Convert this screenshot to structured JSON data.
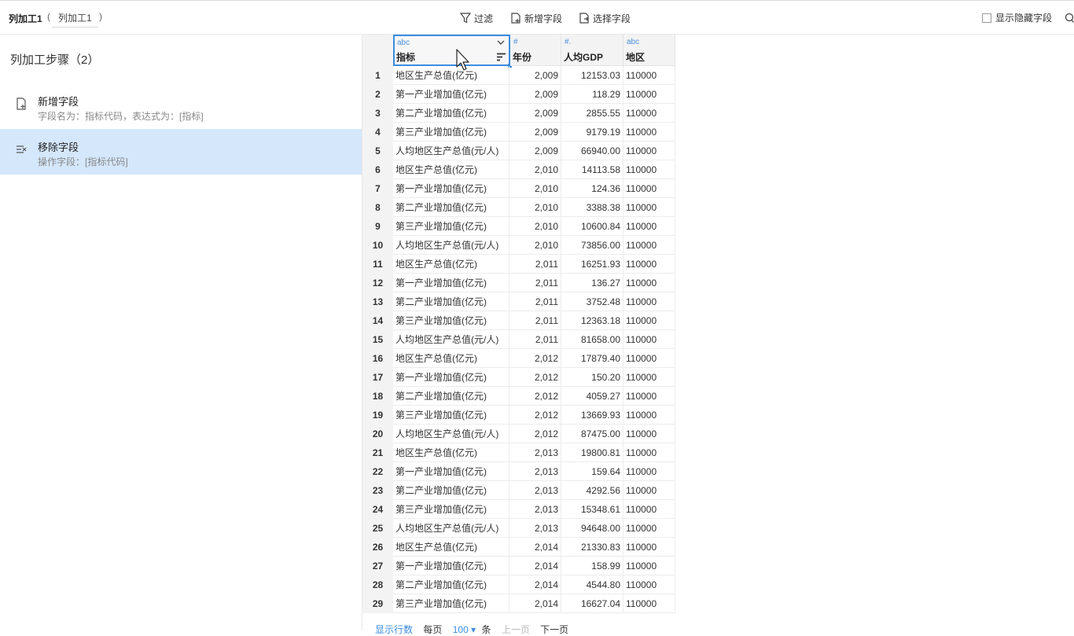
{
  "toolbar": {
    "title": "列加工1",
    "paren_open": "(",
    "name": "列加工1",
    "paren_close": ")",
    "filter_label": "过滤",
    "add_field_label": "新增字段",
    "select_field_label": "选择字段",
    "show_hidden_label": "显示隐藏字段"
  },
  "steps": {
    "title": "列加工步骤（2）",
    "items": [
      {
        "name": "新增字段",
        "desc": "字段名为：指标代码，表达式为：[指标]"
      },
      {
        "name": "移除字段",
        "desc": "操作字段：[指标代码]"
      }
    ]
  },
  "table": {
    "columns": [
      {
        "type": "abc",
        "name": "指标"
      },
      {
        "type": "#",
        "name": "年份"
      },
      {
        "type": "#.",
        "name": "人均GDP"
      },
      {
        "type": "abc",
        "name": "地区"
      }
    ],
    "rows": [
      [
        "1",
        "地区生产总值(亿元)",
        "2,009",
        "12153.03",
        "110000"
      ],
      [
        "2",
        "第一产业增加值(亿元)",
        "2,009",
        "118.29",
        "110000"
      ],
      [
        "3",
        "第二产业增加值(亿元)",
        "2,009",
        "2855.55",
        "110000"
      ],
      [
        "4",
        "第三产业增加值(亿元)",
        "2,009",
        "9179.19",
        "110000"
      ],
      [
        "5",
        "人均地区生产总值(元/人)",
        "2,009",
        "66940.00",
        "110000"
      ],
      [
        "6",
        "地区生产总值(亿元)",
        "2,010",
        "14113.58",
        "110000"
      ],
      [
        "7",
        "第一产业增加值(亿元)",
        "2,010",
        "124.36",
        "110000"
      ],
      [
        "8",
        "第二产业增加值(亿元)",
        "2,010",
        "3388.38",
        "110000"
      ],
      [
        "9",
        "第三产业增加值(亿元)",
        "2,010",
        "10600.84",
        "110000"
      ],
      [
        "10",
        "人均地区生产总值(元/人)",
        "2,010",
        "73856.00",
        "110000"
      ],
      [
        "11",
        "地区生产总值(亿元)",
        "2,011",
        "16251.93",
        "110000"
      ],
      [
        "12",
        "第一产业增加值(亿元)",
        "2,011",
        "136.27",
        "110000"
      ],
      [
        "13",
        "第二产业增加值(亿元)",
        "2,011",
        "3752.48",
        "110000"
      ],
      [
        "14",
        "第三产业增加值(亿元)",
        "2,011",
        "12363.18",
        "110000"
      ],
      [
        "15",
        "人均地区生产总值(元/人)",
        "2,011",
        "81658.00",
        "110000"
      ],
      [
        "16",
        "地区生产总值(亿元)",
        "2,012",
        "17879.40",
        "110000"
      ],
      [
        "17",
        "第一产业增加值(亿元)",
        "2,012",
        "150.20",
        "110000"
      ],
      [
        "18",
        "第二产业增加值(亿元)",
        "2,012",
        "4059.27",
        "110000"
      ],
      [
        "19",
        "第三产业增加值(亿元)",
        "2,012",
        "13669.93",
        "110000"
      ],
      [
        "20",
        "人均地区生产总值(元/人)",
        "2,012",
        "87475.00",
        "110000"
      ],
      [
        "21",
        "地区生产总值(亿元)",
        "2,013",
        "19800.81",
        "110000"
      ],
      [
        "22",
        "第一产业增加值(亿元)",
        "2,013",
        "159.64",
        "110000"
      ],
      [
        "23",
        "第二产业增加值(亿元)",
        "2,013",
        "4292.56",
        "110000"
      ],
      [
        "24",
        "第三产业增加值(亿元)",
        "2,013",
        "15348.61",
        "110000"
      ],
      [
        "25",
        "人均地区生产总值(元/人)",
        "2,013",
        "94648.00",
        "110000"
      ],
      [
        "26",
        "地区生产总值(亿元)",
        "2,014",
        "21330.83",
        "110000"
      ],
      [
        "27",
        "第一产业增加值(亿元)",
        "2,014",
        "158.99",
        "110000"
      ],
      [
        "28",
        "第二产业增加值(亿元)",
        "2,014",
        "4544.80",
        "110000"
      ],
      [
        "29",
        "第三产业增加值(亿元)",
        "2,014",
        "16627.04",
        "110000"
      ]
    ]
  },
  "footer": {
    "display_rows": "显示行数",
    "per_page": "每页",
    "page_size": "100 ▾",
    "unit": "条",
    "prev": "上一页",
    "next": "下一页"
  },
  "colors": {
    "accent": "#3b8de0",
    "active_step": "#d4e7fb"
  }
}
